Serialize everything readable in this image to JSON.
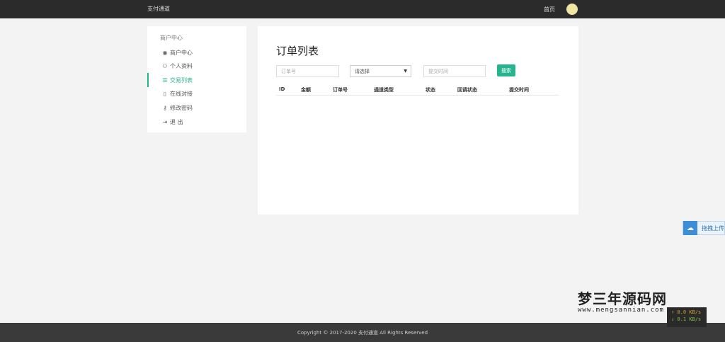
{
  "header": {
    "brand": "支付通道",
    "home_label": "首页"
  },
  "sidebar": {
    "title": "商户中心",
    "items": [
      {
        "icon": "user-circle-icon",
        "glyph": "◉",
        "label": "商户中心"
      },
      {
        "icon": "person-icon",
        "glyph": "⚇",
        "label": "个人资料"
      },
      {
        "icon": "list-icon",
        "glyph": "☰",
        "label": "交易列表"
      },
      {
        "icon": "document-icon",
        "glyph": "▯",
        "label": "在线对接"
      },
      {
        "icon": "key-icon",
        "glyph": "⚷",
        "label": "修改密码"
      },
      {
        "icon": "logout-icon",
        "glyph": "⇥",
        "label": "退 出"
      }
    ]
  },
  "main": {
    "title": "订单列表",
    "filters": {
      "order_placeholder": "订单号",
      "select_value": "请选择",
      "time_placeholder": "提交时间",
      "search_label": "搜索"
    },
    "columns": [
      "ID",
      "金额",
      "订单号",
      "通道类型",
      "状态",
      "回调状态",
      "提交时间"
    ]
  },
  "upload_widget": {
    "label": "拖拽上传"
  },
  "watermark": {
    "text": "梦三年源码网",
    "url": "www.mengsannian.com"
  },
  "netspeed": {
    "up": "↑ 0.0 KB/s",
    "down": "↓ 0.1 KB/s"
  },
  "footer": {
    "copyright": "Copyright © 2017-2020 支付通道 All Rights Reserved"
  },
  "colors": {
    "accent": "#25b48e",
    "topbar": "#2b2b2b",
    "footer": "#3a3a3a"
  }
}
